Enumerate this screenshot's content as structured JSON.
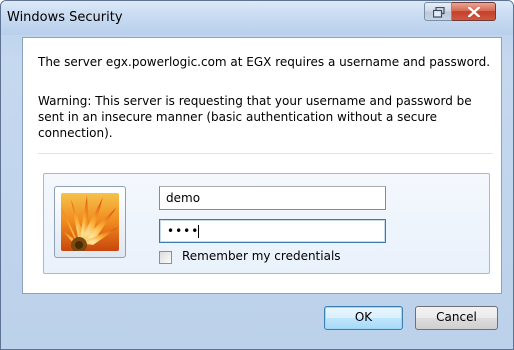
{
  "window": {
    "title": "Windows Security"
  },
  "message": {
    "primary": "The server egx.powerlogic.com at EGX requires a username and password.",
    "warning": "Warning: This server is requesting that your username and password be sent in an insecure manner (basic authentication without a secure connection)."
  },
  "credentials": {
    "username_value": "demo",
    "password_masked": "••••",
    "remember_label": "Remember my credentials",
    "remember_checked": false
  },
  "buttons": {
    "ok_label": "OK",
    "cancel_label": "Cancel"
  },
  "colors": {
    "frame_accent": "#bcd1ea",
    "close_button": "#c4402b",
    "focus_border": "#3d7bad"
  },
  "icons": {
    "restore": "restore-icon",
    "close": "close-icon",
    "avatar": "flower-avatar-icon"
  }
}
